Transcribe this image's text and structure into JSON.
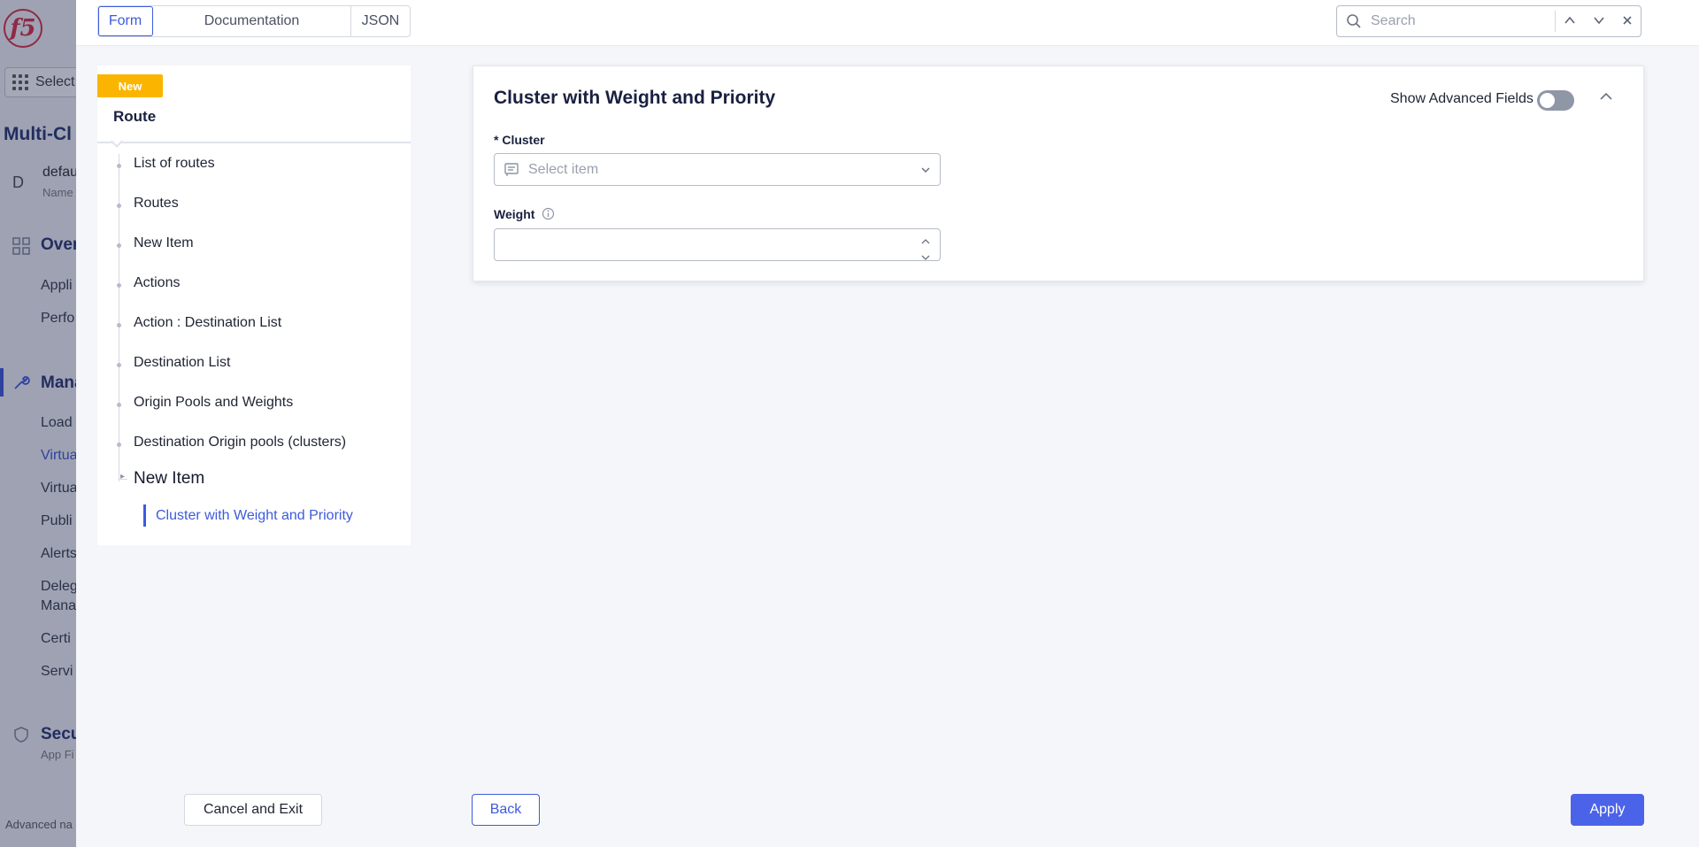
{
  "background": {
    "logo_text": "f5",
    "select_label": "Select",
    "app_title": "Multi-Cl",
    "namespace": {
      "letter": "D",
      "name": "defau",
      "sub": "Name"
    },
    "overview_section": "Over",
    "overview_items": [
      "Appli",
      "Perfo"
    ],
    "manage_section": "Mana",
    "manage_items": [
      "Load",
      "Virtua",
      "Virtua",
      "Publi",
      "Alerts",
      "Deleg",
      "Mana",
      "Certi",
      "Servi"
    ],
    "security_section": "Secu",
    "security_sub": "App Fi",
    "footer": "Advanced na"
  },
  "toolbar": {
    "tabs": [
      {
        "label": "Form",
        "active": true
      },
      {
        "label": "Documentation",
        "active": false
      },
      {
        "label": "JSON",
        "active": false
      }
    ],
    "search_placeholder": "Search"
  },
  "nav": {
    "badge": "New",
    "title": "Route",
    "items": [
      "List of routes",
      "Routes",
      "New Item",
      "Actions",
      "Action : Destination List",
      "Destination List",
      "Origin Pools and Weights",
      "Destination Origin pools (clusters)"
    ],
    "current": "New Item",
    "sub_current": "Cluster with Weight and Priority"
  },
  "form": {
    "title": "Cluster with Weight and Priority",
    "advanced_label": "Show Advanced Fields",
    "advanced_on": false,
    "cluster_label": "* Cluster",
    "cluster_placeholder": "Select item",
    "weight_label": "Weight",
    "weight_value": ""
  },
  "footer": {
    "cancel_label": "Cancel and Exit",
    "back_label": "Back",
    "apply_label": "Apply"
  },
  "colors": {
    "accent": "#3d5bdb",
    "apply_button": "#4b63e8",
    "badge": "#fbb500",
    "brand_red": "#d9263d"
  }
}
